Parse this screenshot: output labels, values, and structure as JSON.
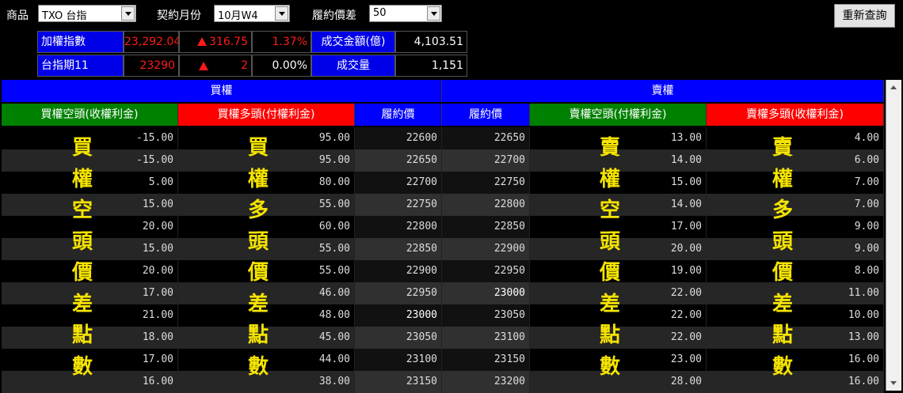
{
  "toolbar": {
    "product_label": "商品",
    "product_value": "TXO 台指",
    "month_label": "契約月份",
    "month_value": "10月W4",
    "spread_label": "履約價差",
    "spread_value": "50",
    "refresh_label": "重新查詢"
  },
  "info": {
    "row1": {
      "name": "加權指數",
      "price": "23,292.04",
      "change": "316.75",
      "pct": "1.37%",
      "vol_label": "成交金額(億)",
      "vol_value": "4,103.51"
    },
    "row2": {
      "name": "台指期11",
      "price": "23290",
      "change": "2",
      "pct": "0.00%",
      "vol_label": "成交量",
      "vol_value": "1,151"
    }
  },
  "table": {
    "call_header": "買權",
    "put_header": "賣權",
    "columns": [
      "買權空頭(收權利金)",
      "買權多頭(付權利金)",
      "履約價",
      "履約價",
      "賣權空頭(付權利金)",
      "賣權多頭(收權利金)"
    ],
    "header_colors": [
      "#008000",
      "#ff0000",
      "#0000ff",
      "#0000ff",
      "#008000",
      "#ff0000"
    ],
    "vertical_labels": {
      "call_short": [
        "買",
        "權",
        "空",
        "頭",
        "價",
        "差",
        "點",
        "數"
      ],
      "call_long": [
        "買",
        "權",
        "多",
        "頭",
        "價",
        "差",
        "點",
        "數"
      ],
      "put_short": [
        "賣",
        "權",
        "空",
        "頭",
        "價",
        "差",
        "點",
        "數"
      ],
      "put_long": [
        "賣",
        "權",
        "多",
        "頭",
        "價",
        "差",
        "點",
        "數"
      ]
    },
    "rows": [
      {
        "c_short": "-15.00",
        "c_long": "95.00",
        "c_strike": "22600",
        "p_strike": "22650",
        "p_short": "13.00",
        "p_long": "4.00"
      },
      {
        "c_short": "-15.00",
        "c_long": "95.00",
        "c_strike": "22650",
        "p_strike": "22700",
        "p_short": "14.00",
        "p_long": "6.00"
      },
      {
        "c_short": "5.00",
        "c_long": "80.00",
        "c_strike": "22700",
        "p_strike": "22750",
        "p_short": "15.00",
        "p_long": "7.00"
      },
      {
        "c_short": "15.00",
        "c_long": "55.00",
        "c_strike": "22750",
        "p_strike": "22800",
        "p_short": "14.00",
        "p_long": "7.00"
      },
      {
        "c_short": "20.00",
        "c_long": "60.00",
        "c_strike": "22800",
        "p_strike": "22850",
        "p_short": "17.00",
        "p_long": "9.00"
      },
      {
        "c_short": "15.00",
        "c_long": "55.00",
        "c_strike": "22850",
        "p_strike": "22900",
        "p_short": "20.00",
        "p_long": "9.00"
      },
      {
        "c_short": "20.00",
        "c_long": "55.00",
        "c_strike": "22900",
        "p_strike": "22950",
        "p_short": "19.00",
        "p_long": "8.00"
      },
      {
        "c_short": "17.00",
        "c_long": "46.00",
        "c_strike": "22950",
        "p_strike": "23000",
        "p_short": "22.00",
        "p_long": "11.00",
        "p_hl": true
      },
      {
        "c_short": "21.00",
        "c_long": "48.00",
        "c_strike": "23000",
        "p_strike": "23050",
        "p_short": "22.00",
        "p_long": "10.00",
        "c_hl": true
      },
      {
        "c_short": "18.00",
        "c_long": "45.00",
        "c_strike": "23050",
        "p_strike": "23100",
        "p_short": "22.00",
        "p_long": "13.00"
      },
      {
        "c_short": "17.00",
        "c_long": "44.00",
        "c_strike": "23100",
        "p_strike": "23150",
        "p_short": "23.00",
        "p_long": "16.00"
      },
      {
        "c_short": "16.00",
        "c_long": "38.00",
        "c_strike": "23150",
        "p_strike": "23200",
        "p_short": "28.00",
        "p_long": "16.00"
      }
    ]
  }
}
